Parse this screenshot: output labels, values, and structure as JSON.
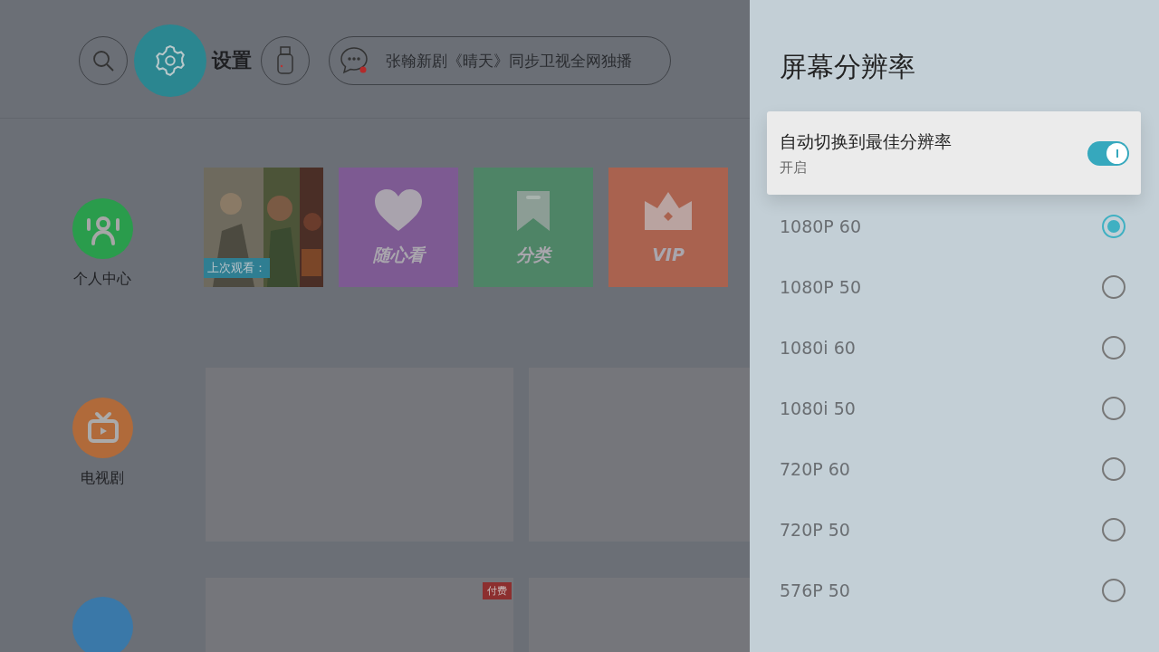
{
  "header": {
    "settings_label": "设置",
    "news": "张翰新剧《晴天》同步卫视全网独播"
  },
  "nav": [
    {
      "kind": "person",
      "label": "个人中心",
      "color": "#2a9c4c"
    },
    {
      "kind": "tv",
      "label": "电视剧",
      "color": "#b06a3a"
    },
    {
      "kind": "plain",
      "color": "#3a78a8"
    }
  ],
  "tiles": [
    {
      "kind": "recent",
      "label": "上次观看："
    },
    {
      "kind": "heart",
      "label": "随心看",
      "color": "#7d5a92"
    },
    {
      "kind": "bookmark",
      "label": "分类",
      "color": "#4e8466"
    },
    {
      "kind": "crown",
      "label": "VIP",
      "color": "#a9624f"
    }
  ],
  "card_rows": [
    [
      {},
      {}
    ],
    [
      {
        "badge": "付费"
      },
      {}
    ]
  ],
  "panel": {
    "title": "屏幕分辨率",
    "auto": {
      "label": "自动切换到最佳分辨率",
      "status": "开启",
      "on": true
    },
    "options": [
      {
        "label": "1080P 60",
        "selected": true
      },
      {
        "label": "1080P 50",
        "selected": false
      },
      {
        "label": "1080i 60",
        "selected": false
      },
      {
        "label": "1080i 50",
        "selected": false
      },
      {
        "label": "720P 60",
        "selected": false
      },
      {
        "label": "720P 50",
        "selected": false
      },
      {
        "label": "576P 50",
        "selected": false
      }
    ]
  }
}
